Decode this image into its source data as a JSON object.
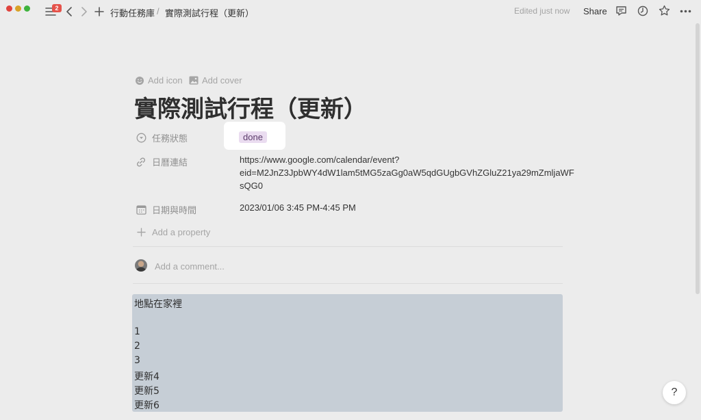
{
  "topbar": {
    "notification_count": "2",
    "breadcrumb_parent": "行動任務庫",
    "breadcrumb_separator": "/",
    "breadcrumb_current": "實際測試行程（更新）",
    "edited": "Edited just now",
    "share": "Share"
  },
  "page": {
    "add_icon": "Add icon",
    "add_cover": "Add cover",
    "title": "實際測試行程（更新）"
  },
  "properties": {
    "status": {
      "label": "任務狀態",
      "value": "done",
      "color": "#eadcf0"
    },
    "link": {
      "label": "日曆連結",
      "value_line1": "https://www.google.com/calendar/event?",
      "value_line2": "eid=M2JnZ3JpbWY4dW1lam5tMG5zaGg0aW5qdGUgbGVhZGluZ21ya29mZmljaWF",
      "value_line3": "sQG0"
    },
    "datetime": {
      "label": "日期與時間",
      "value": "2023/01/06 3:45 PM-4:45 PM"
    },
    "add_property": "Add a property"
  },
  "comment": {
    "placeholder": "Add a comment..."
  },
  "body": {
    "lines": [
      "地點在家裡",
      "",
      "1",
      "2",
      "3",
      "更新4",
      "更新5",
      "更新6"
    ]
  },
  "help": "?"
}
